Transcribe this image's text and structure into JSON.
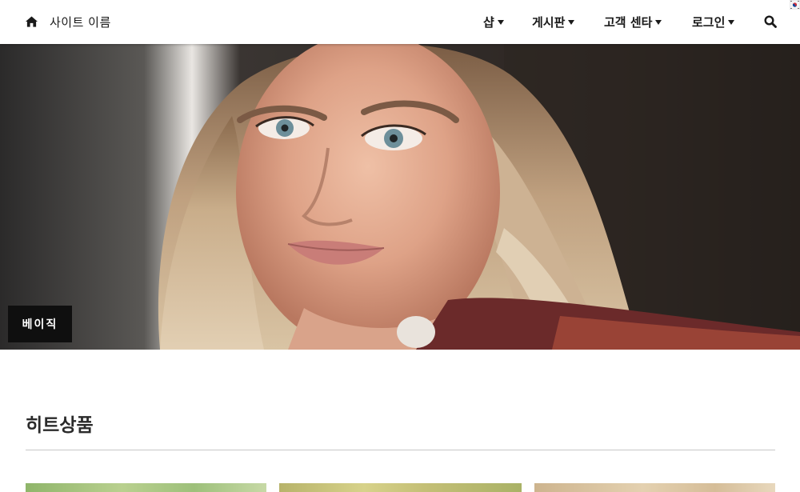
{
  "header": {
    "site_name": "사이트 이름",
    "home_icon": "home-icon",
    "nav": [
      {
        "label": "샵",
        "icon": "caret-down-icon"
      },
      {
        "label": "게시판",
        "icon": "caret-down-icon"
      },
      {
        "label": "고객 센타",
        "icon": "caret-down-icon"
      },
      {
        "label": "로그인",
        "icon": "caret-down-icon"
      }
    ],
    "search_icon": "search-icon",
    "language_flag": "korea-flag-icon"
  },
  "hero": {
    "caption": "베이직"
  },
  "main": {
    "section_title": "히트상품",
    "products": [
      {
        "image": "product-image"
      },
      {
        "image": "product-image"
      },
      {
        "image": "product-image"
      }
    ]
  },
  "colors": {
    "header_bg": "#ffffff",
    "caption_bg": "#0f0f0f",
    "text": "#1a1a1a"
  }
}
